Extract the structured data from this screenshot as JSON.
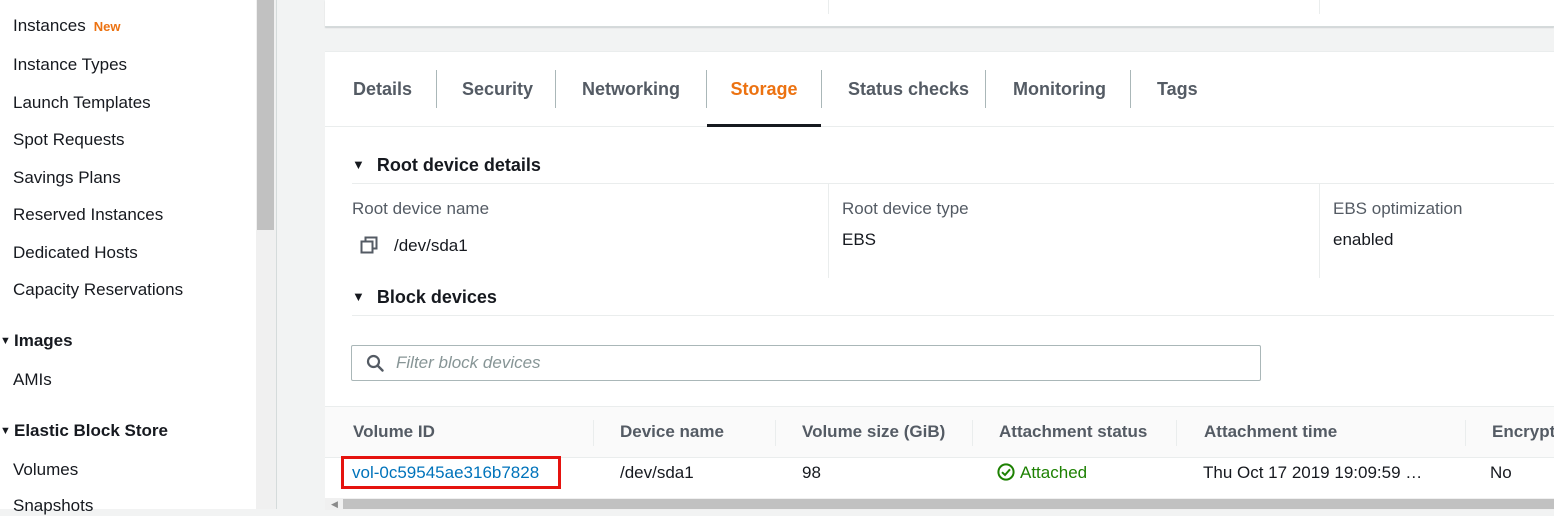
{
  "sidebar": {
    "items": [
      {
        "label": "Instances",
        "badge": "New"
      },
      {
        "label": "Instance Types"
      },
      {
        "label": "Launch Templates"
      },
      {
        "label": "Spot Requests"
      },
      {
        "label": "Savings Plans"
      },
      {
        "label": "Reserved Instances"
      },
      {
        "label": "Dedicated Hosts"
      },
      {
        "label": "Capacity Reservations"
      }
    ],
    "images_section": {
      "label": "Images",
      "items": [
        {
          "label": "AMIs"
        }
      ]
    },
    "ebs_section": {
      "label": "Elastic Block Store",
      "items": [
        {
          "label": "Volumes"
        },
        {
          "label": "Snapshots"
        }
      ]
    }
  },
  "tabs": [
    {
      "label": "Details"
    },
    {
      "label": "Security"
    },
    {
      "label": "Networking"
    },
    {
      "label": "Storage",
      "active": true
    },
    {
      "label": "Status checks"
    },
    {
      "label": "Monitoring"
    },
    {
      "label": "Tags"
    }
  ],
  "root_device": {
    "heading": "Root device details",
    "name_label": "Root device name",
    "name_value": "/dev/sda1",
    "type_label": "Root device type",
    "type_value": "EBS",
    "ebs_label": "EBS optimization",
    "ebs_value": "enabled"
  },
  "block_devices": {
    "heading": "Block devices",
    "filter_placeholder": "Filter block devices",
    "columns": [
      "Volume ID",
      "Device name",
      "Volume size (GiB)",
      "Attachment status",
      "Attachment time",
      "Encrypt"
    ],
    "rows": [
      {
        "volume_id": "vol-0c59545ae316b7828",
        "device_name": "/dev/sda1",
        "size": "98",
        "status": "Attached",
        "time": "Thu Oct 17 2019 19:09:59 …",
        "encrypted": "No"
      }
    ]
  },
  "colors": {
    "accent_orange": "#ec7211",
    "link_blue": "#0073bb",
    "success_green": "#1d8102",
    "highlight_red": "#e5130f"
  },
  "icons": {
    "copy": "copy-icon",
    "search": "search-icon",
    "status": "check-circle-icon",
    "collapse": "caret-down-icon"
  }
}
